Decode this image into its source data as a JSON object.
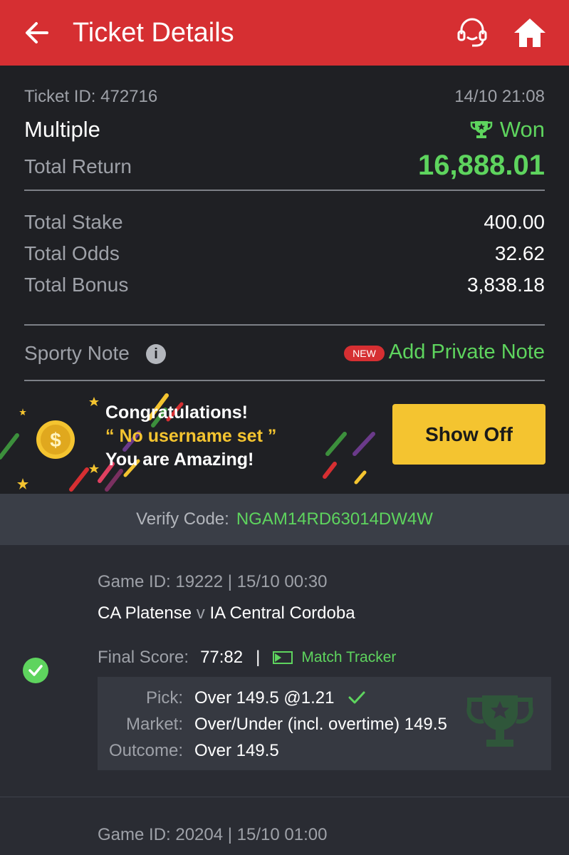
{
  "header": {
    "title": "Ticket Details",
    "back_icon": "arrow-left-icon",
    "support_icon": "headset-icon",
    "home_icon": "home-icon",
    "color": "#d62f32"
  },
  "ticket": {
    "id_label": "Ticket ID: 472716",
    "date": "14/10 21:08",
    "type": "Multiple",
    "status": "Won",
    "total_return_label": "Total Return",
    "total_return": "16,888.01",
    "total_stake_label": "Total Stake",
    "total_stake": "400.00",
    "total_odds_label": "Total Odds",
    "total_odds": "32.62",
    "total_bonus_label": "Total Bonus",
    "total_bonus": "3,838.18"
  },
  "note": {
    "label": "Sporty Note",
    "badge": "NEW",
    "action": "Add Private Note"
  },
  "banner": {
    "line1": "Congratulations!",
    "line2": "“ No username set ”",
    "line3": "You are Amazing!",
    "button": "Show Off"
  },
  "verify": {
    "label": "Verify Code:",
    "code": "NGAM14RD63014DW4W"
  },
  "games": [
    {
      "id_line": "Game ID: 19222 | 15/10 00:30",
      "home": "CA Platense",
      "vs": "v",
      "away": "IA Central Cordoba",
      "final_score_label": "Final Score:",
      "final_score": "77:82",
      "separator": "|",
      "tracker": "Match Tracker",
      "pick_label": "Pick:",
      "pick": "Over 149.5 @1.21",
      "market_label": "Market:",
      "market": "Over/Under (incl. overtime) 149.5",
      "outcome_label": "Outcome:",
      "outcome": "Over 149.5"
    },
    {
      "id_line": "Game ID: 20204 | 15/10 01:00"
    }
  ],
  "accent_green": "#5ed45e",
  "accent_yellow": "#f4c430"
}
